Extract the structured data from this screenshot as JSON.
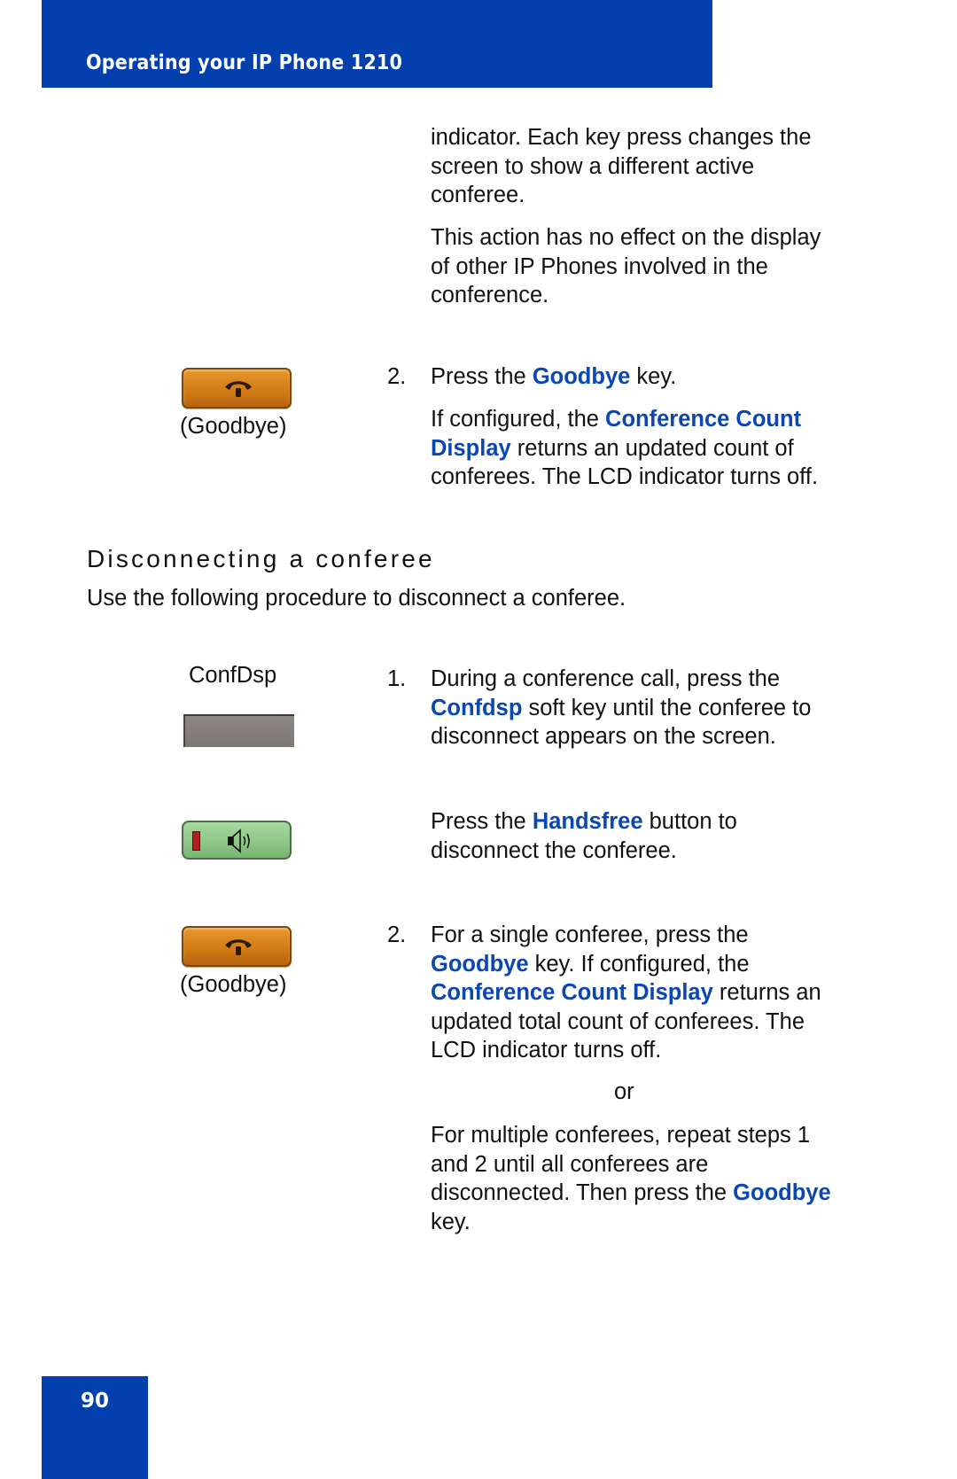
{
  "header": {
    "title": "Operating your IP Phone 1210"
  },
  "colors": {
    "brand_blue": "#0340ad",
    "keyword_blue": "#0a47b0",
    "goodbye_key_orange": "#d9862a",
    "handsfree_key_green": "#8cc585"
  },
  "top_section": {
    "para1_lines": [
      "indicator. Each key press changes the",
      "screen to show a different active",
      "conferee."
    ],
    "para2_lines": [
      "This action has no effect on the display",
      "of other IP Phones involved in the",
      "conference."
    ],
    "step2": {
      "number": "2.",
      "line1": {
        "pre": "Press the ",
        "kw": "Goodbye",
        "post": " key."
      },
      "line2": {
        "pre": "If configured, the ",
        "kw": "Conference Count"
      },
      "line3": {
        "kw": "Display",
        "post": " returns an updated count of"
      },
      "line4": "conferees. The LCD indicator turns off."
    },
    "goodbye_key": {
      "icon": "hang-up-phone-icon",
      "caption": "(Goodbye)"
    }
  },
  "section": {
    "heading": "Disconnecting a conferee",
    "intro": "Use the following procedure to disconnect a conferee."
  },
  "procedure": {
    "confdsp_key": {
      "label": "ConfDsp"
    },
    "step1": {
      "number": "1.",
      "line1": "During a conference call, press the",
      "line2": {
        "kw": "Confdsp",
        "post": " soft key until the conferee to"
      },
      "line3": "disconnect appears on the screen."
    },
    "handsfree_key": {
      "icon": "speaker-icon"
    },
    "handsfree_para": {
      "line1": {
        "pre": "Press the ",
        "kw": "Handsfree",
        "post": " button to"
      },
      "line2": "disconnect the conferee."
    },
    "goodbye_key": {
      "icon": "hang-up-phone-icon",
      "caption": "(Goodbye)"
    },
    "step2": {
      "number": "2.",
      "line1": "For a single conferee, press the",
      "line2": {
        "kw": "Goodbye",
        "post": " key. If configured, the"
      },
      "line3": {
        "kw": "Conference Count Display",
        "post": " returns an"
      },
      "line4": "updated total count of conferees. The",
      "line5": "LCD indicator turns off."
    },
    "or_text": "or",
    "multi_para": {
      "line1": "For multiple conferees, repeat steps 1",
      "line2": "and 2 until all conferees are",
      "line3": {
        "pre": "disconnected. Then press the ",
        "kw": "Goodbye"
      },
      "line4": "key."
    }
  },
  "footer": {
    "page_number": "90"
  }
}
